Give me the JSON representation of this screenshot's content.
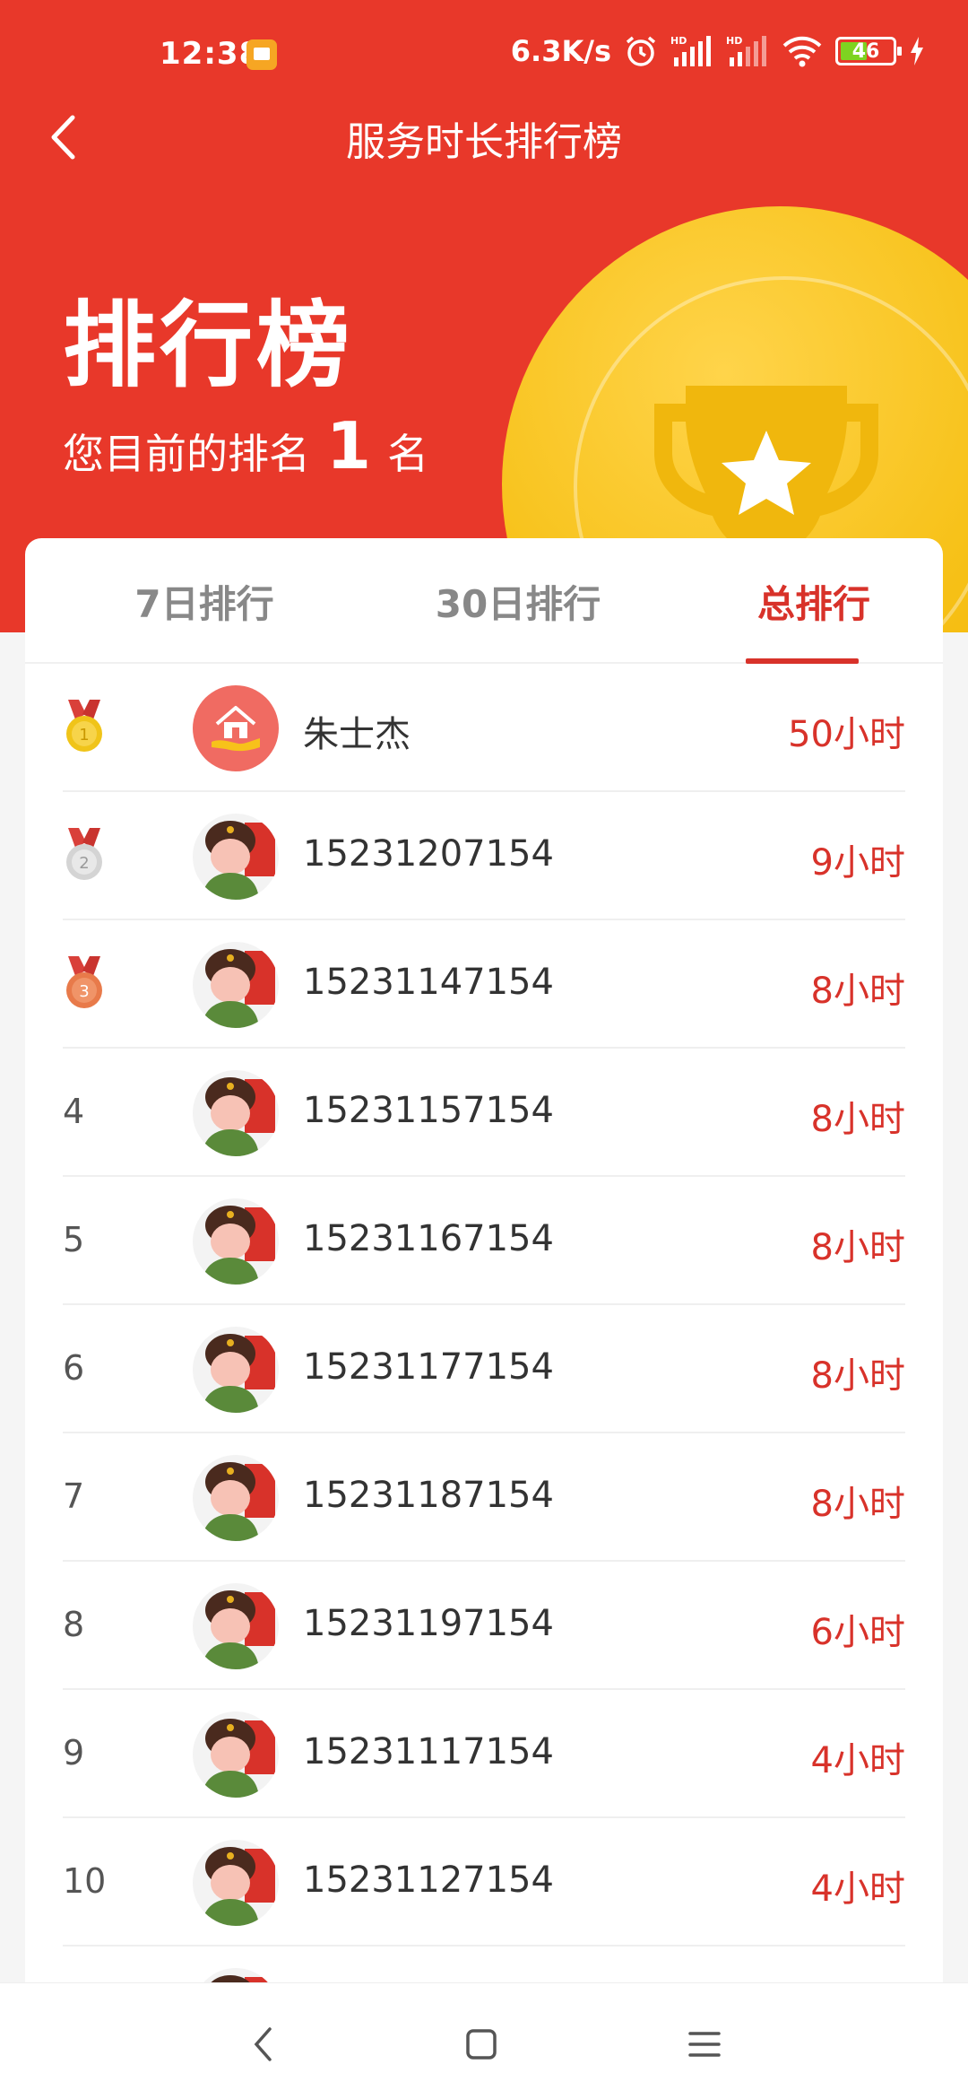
{
  "status_bar": {
    "time": "12:38",
    "speed": "6.3K/s",
    "battery": "46"
  },
  "nav": {
    "title": "服务时长排行榜"
  },
  "hero": {
    "title": "排行榜",
    "rank_prefix": "您目前的排名",
    "rank_value": "1",
    "rank_suffix": "名"
  },
  "tabs": [
    {
      "label": "7日排行"
    },
    {
      "label": "30日排行"
    },
    {
      "label": "总排行"
    }
  ],
  "active_tab": "总排行",
  "colors": {
    "brand_red": "#e8382a",
    "accent_red": "#d8322a",
    "gold": "#f7c21a"
  },
  "rankings": [
    {
      "rank": "1",
      "name": "朱士杰",
      "hours": "50小时",
      "medal": "gold-medal-icon"
    },
    {
      "rank": "2",
      "name": "15231207154",
      "hours": "9小时",
      "medal": "silver-medal-icon"
    },
    {
      "rank": "3",
      "name": "15231147154",
      "hours": "8小时",
      "medal": "bronze-medal-icon"
    },
    {
      "rank": "4",
      "name": "15231157154",
      "hours": "8小时"
    },
    {
      "rank": "5",
      "name": "15231167154",
      "hours": "8小时"
    },
    {
      "rank": "6",
      "name": "15231177154",
      "hours": "8小时"
    },
    {
      "rank": "7",
      "name": "15231187154",
      "hours": "8小时"
    },
    {
      "rank": "8",
      "name": "15231197154",
      "hours": "6小时"
    },
    {
      "rank": "9",
      "name": "15231117154",
      "hours": "4小时"
    },
    {
      "rank": "10",
      "name": "15231127154",
      "hours": "4小时"
    }
  ]
}
